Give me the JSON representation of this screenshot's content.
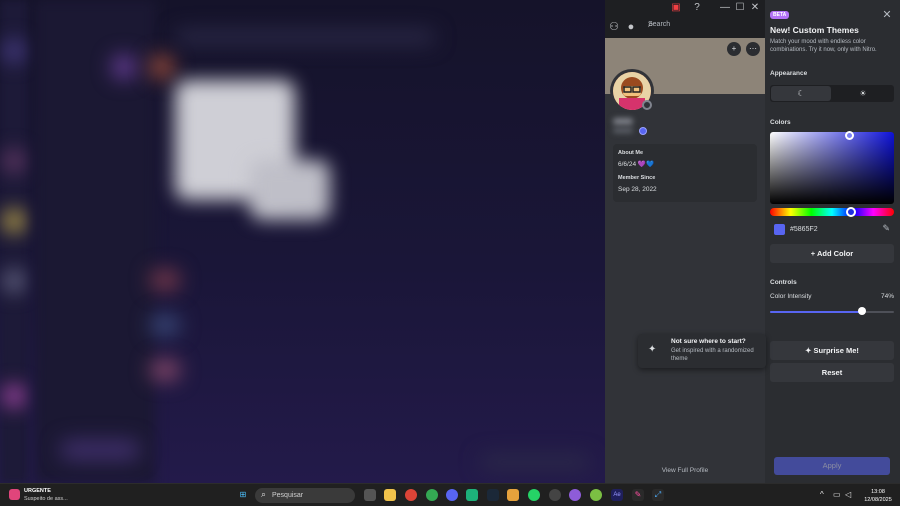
{
  "window": {
    "minimize": "—",
    "maximize": "☐",
    "close": "✕"
  },
  "header": {
    "search_placeholder": "Search"
  },
  "profile": {
    "about_label": "About Me",
    "about_value": "6/6/24 💜💙",
    "member_label": "Member Since",
    "member_value": "Sep 28, 2022",
    "view_full": "View Full Profile",
    "banner_color": "#8d8478"
  },
  "themes": {
    "badge": "BETA",
    "title": "New! Custom Themes",
    "description": "Match your mood with endless color combinations. Try it now, only with Nitro.",
    "appearance_label": "Appearance",
    "dark_icon": "moon-icon",
    "light_icon": "sun-icon",
    "colors_label": "Colors",
    "hex_value": "#5865F2",
    "swatch_color": "#5865F2",
    "add_color": "+ Add Color",
    "controls_label": "Controls",
    "intensity_label": "Color Intensity",
    "intensity_value": "74%",
    "intensity_fraction": 0.74,
    "surprise": "Surprise Me!",
    "reset": "Reset",
    "apply": "Apply"
  },
  "tooltip": {
    "title": "Not sure where to start?",
    "text": "Get inspired with a randomized theme"
  },
  "taskbar": {
    "news_title": "URGENTE",
    "news_sub": "Suspeito de ass...",
    "search_placeholder": "Pesquisar",
    "time": "13:08",
    "date": "12/08/2025"
  }
}
